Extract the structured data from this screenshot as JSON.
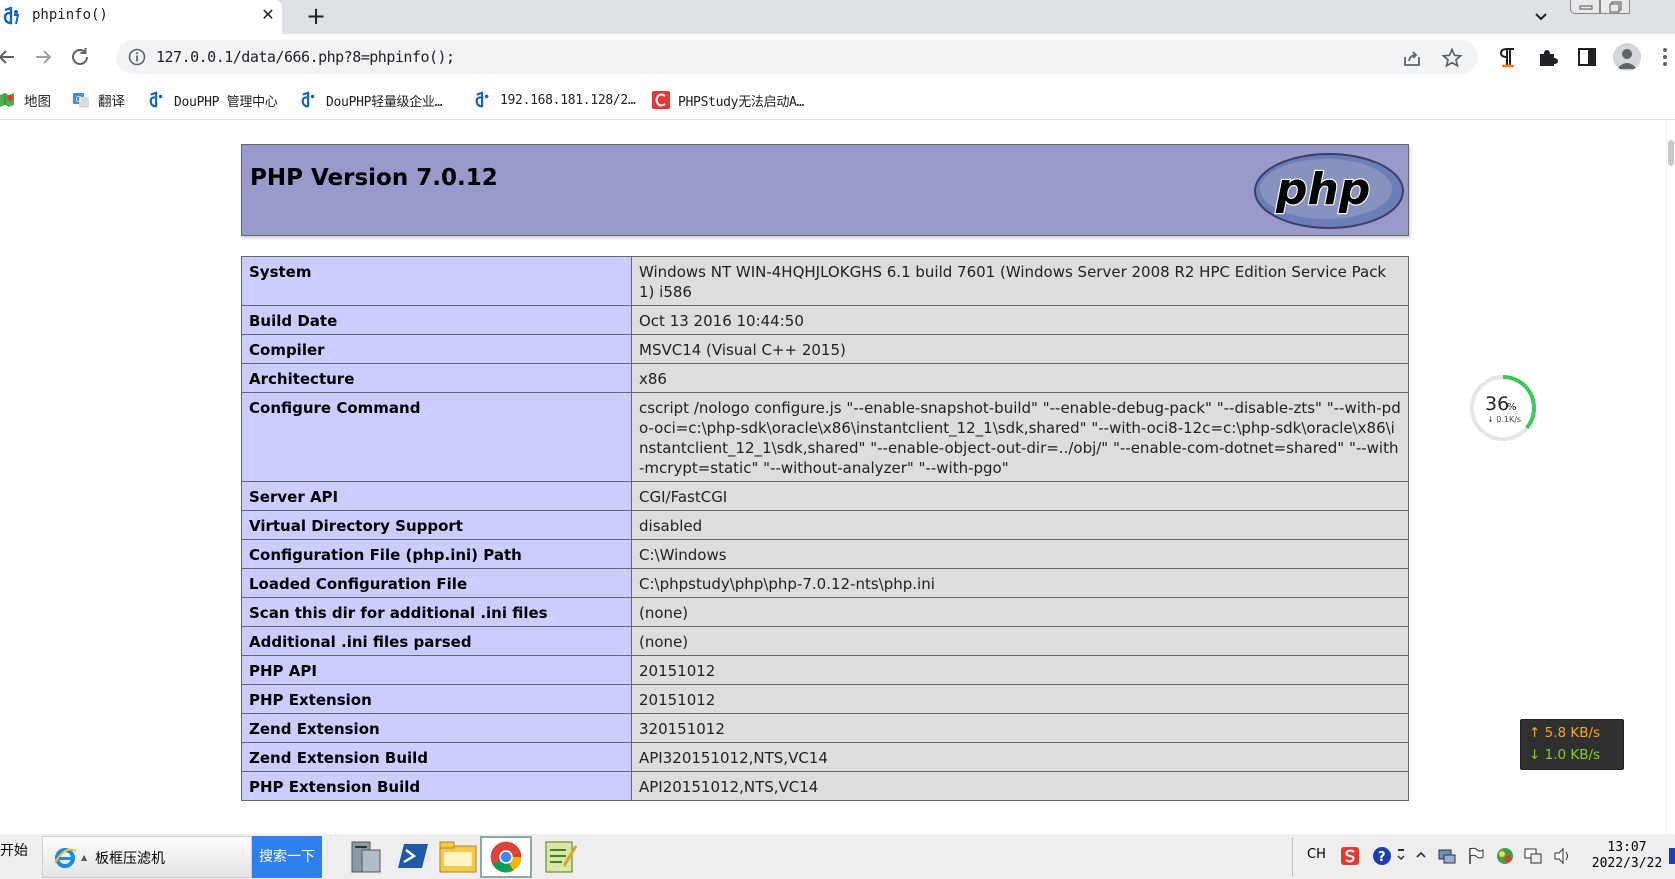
{
  "browser": {
    "tab": {
      "title": "phpinfo()",
      "close_label": "✕"
    },
    "new_tab_label": "+",
    "url": "127.0.0.1/data/666.php?8=phpinfo();"
  },
  "bookmarks": [
    {
      "label": "地图"
    },
    {
      "label": "翻译"
    },
    {
      "label": "DouPHP 管理中心"
    },
    {
      "label": "DouPHP轻量级企业…"
    },
    {
      "label": "192.168.181.128/2…"
    },
    {
      "label": "PHPStudy无法启动A…"
    }
  ],
  "php": {
    "version_title": "PHP Version 7.0.12",
    "logo_text": "php",
    "rows": [
      {
        "key": "System",
        "value": "Windows NT WIN-4HQHJLOKGHS 6.1 build 7601 (Windows Server 2008 R2 HPC Edition Service Pack 1) i586"
      },
      {
        "key": "Build Date",
        "value": "Oct 13 2016 10:44:50"
      },
      {
        "key": "Compiler",
        "value": "MSVC14 (Visual C++ 2015)"
      },
      {
        "key": "Architecture",
        "value": "x86"
      },
      {
        "key": "Configure Command",
        "value": "cscript /nologo configure.js \"--enable-snapshot-build\" \"--enable-debug-pack\" \"--disable-zts\" \"--with-pdo-oci=c:\\php-sdk\\oracle\\x86\\instantclient_12_1\\sdk,shared\" \"--with-oci8-12c=c:\\php-sdk\\oracle\\x86\\instantclient_12_1\\sdk,shared\" \"--enable-object-out-dir=../obj/\" \"--enable-com-dotnet=shared\" \"--with-mcrypt=static\" \"--without-analyzer\" \"--with-pgo\""
      },
      {
        "key": "Server API",
        "value": "CGI/FastCGI"
      },
      {
        "key": "Virtual Directory Support",
        "value": "disabled"
      },
      {
        "key": "Configuration File (php.ini) Path",
        "value": "C:\\Windows"
      },
      {
        "key": "Loaded Configuration File",
        "value": "C:\\phpstudy\\php\\php-7.0.12-nts\\php.ini"
      },
      {
        "key": "Scan this dir for additional .ini files",
        "value": "(none)"
      },
      {
        "key": "Additional .ini files parsed",
        "value": "(none)"
      },
      {
        "key": "PHP API",
        "value": "20151012"
      },
      {
        "key": "PHP Extension",
        "value": "20151012"
      },
      {
        "key": "Zend Extension",
        "value": "320151012"
      },
      {
        "key": "Zend Extension Build",
        "value": "API320151012,NTS,VC14"
      },
      {
        "key": "PHP Extension Build",
        "value": "API20151012,NTS,VC14"
      }
    ]
  },
  "speed_widget": {
    "percent": "36",
    "percent_unit": "%",
    "rate": "↓ 0.1K/s",
    "level": 0.36
  },
  "net_monitor": {
    "upload": "↑ 5.8 KB/s",
    "download": "↓ 1.0 KB/s"
  },
  "taskbar": {
    "start_label": "开始",
    "window_label": "板框压滤机",
    "search_label": "搜索一下",
    "ime_label": "CH",
    "clock_time": "13:07",
    "clock_date": "2022/3/22"
  },
  "colors": {
    "php_header": "#9999cc",
    "key_cell": "#ccccff",
    "value_cell": "#dddddd",
    "net_up": "#f5a623",
    "net_down": "#7ed321"
  }
}
